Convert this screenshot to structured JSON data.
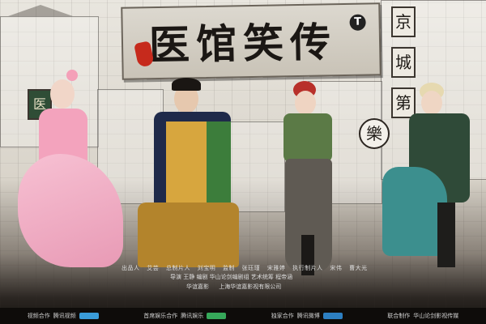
{
  "title": "医馆笑传",
  "title_badge": "T",
  "side_signs": [
    "京",
    "城",
    "第"
  ],
  "left_sign": "医",
  "circle_sign": "樂",
  "credits_line1": [
    "出品人",
    "艾芸",
    "总制片人",
    "刘宝明",
    "监制",
    "张珏瑾",
    "宋雅婷",
    "执行制片人",
    "宋伟",
    "曹大光"
  ],
  "credits_line2": "导演 王静 编剧 华山论剑编剧组 艺术统筹 程帝涵",
  "credits_line3": [
    "华谊嘉影",
    "上海华谊嘉影视有限公司"
  ],
  "bottom_bar": [
    {
      "label": "视频合作",
      "value": "腾讯视频"
    },
    {
      "label": "首席娱乐合作",
      "value": "腾讯娱乐"
    },
    {
      "label": "独家合作",
      "value": "腾讯微博"
    },
    {
      "label": "联合制作",
      "value": "华山论剑影视传媒"
    }
  ],
  "colors": {
    "accent_red": "#c62a1c",
    "board": "#d6d1c7",
    "ink": "#1b1714"
  }
}
